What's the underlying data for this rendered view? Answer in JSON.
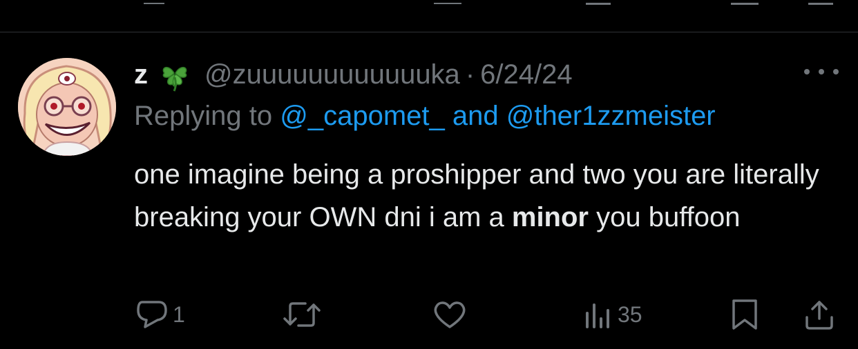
{
  "tweet": {
    "display_name": "z",
    "emoji_icon": "four-leaf-clover-icon",
    "handle": "@zuuuuuuuuuuuuka",
    "separator": "·",
    "date": "6/24/24",
    "replying_prefix": "Replying to ",
    "replying_user_1": "@_capomet_",
    "replying_and": " and ",
    "replying_user_2": "@ther1zzmeister",
    "body_part1": "one imagine being a proshipper and two you are literally breaking your OWN dni i am a ",
    "body_bold": "minor",
    "body_part2": " you buffoon"
  },
  "actions": {
    "reply_count": "1",
    "retweet_count": "",
    "like_count": "",
    "views_count": "35"
  },
  "colors": {
    "background": "#000000",
    "text": "#e7e9ea",
    "muted": "#71767b",
    "link": "#1d9bf0",
    "divider": "#2f3336"
  }
}
